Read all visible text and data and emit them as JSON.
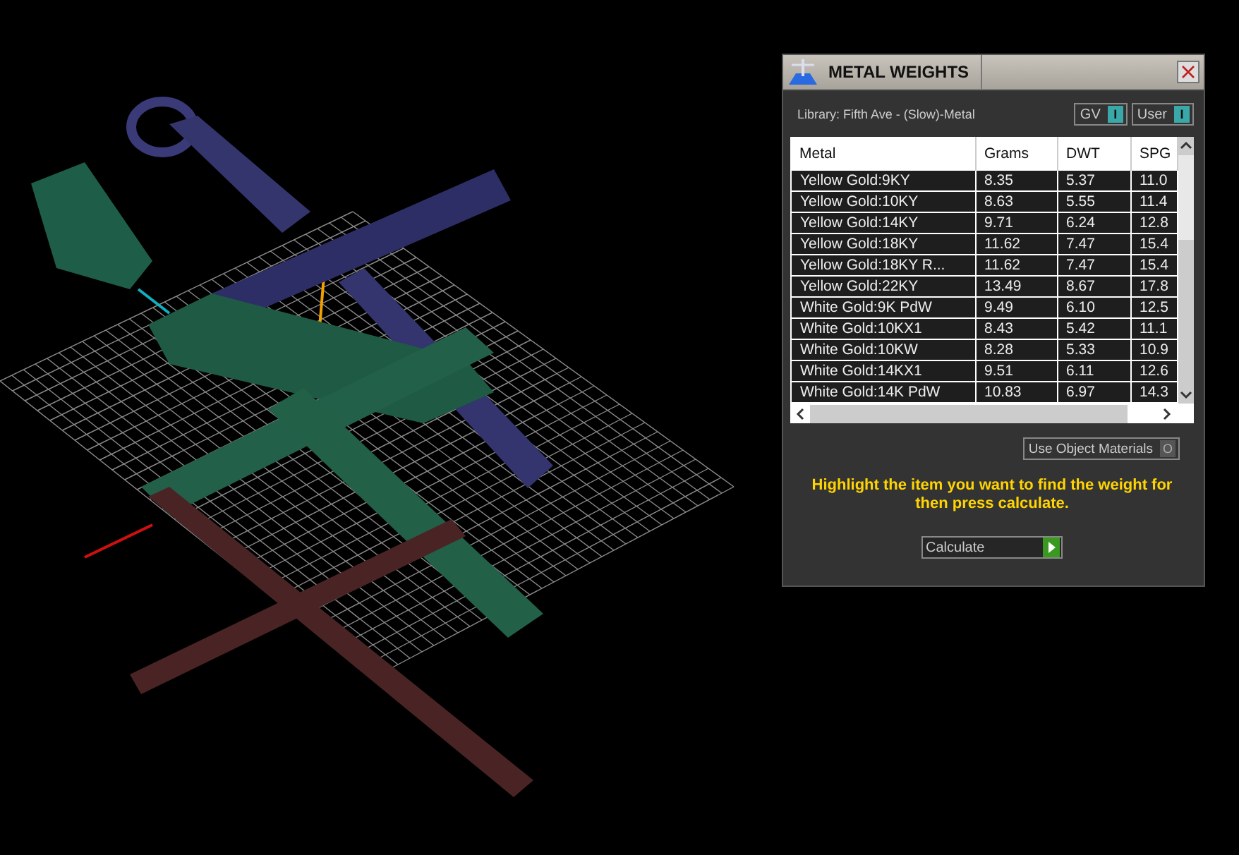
{
  "panel": {
    "title": "METAL WEIGHTS",
    "library": "Library: Fifth Ave - (Slow)-Metal",
    "toggles": [
      {
        "label": "GV",
        "glyph": "I",
        "on": true
      },
      {
        "label": "User",
        "glyph": "I",
        "on": true
      }
    ],
    "table": {
      "columns": [
        "Metal",
        "Grams",
        "DWT",
        "SPG"
      ],
      "rows": [
        {
          "cells": [
            "Yellow Gold:9KY",
            "8.35",
            "5.37",
            "11.0"
          ],
          "selected": false
        },
        {
          "cells": [
            "Yellow Gold:10KY",
            "8.63",
            "5.55",
            "11.4"
          ],
          "selected": false
        },
        {
          "cells": [
            "Yellow Gold:14KY",
            "9.71",
            "6.24",
            "12.8"
          ],
          "selected": false
        },
        {
          "cells": [
            "Yellow Gold:18KY",
            "11.62",
            "7.47",
            "15.4"
          ],
          "selected": false
        },
        {
          "cells": [
            "Yellow Gold:18KY R...",
            "11.62",
            "7.47",
            "15.4"
          ],
          "selected": false
        },
        {
          "cells": [
            "Yellow Gold:22KY",
            "13.49",
            "8.67",
            "17.8"
          ],
          "selected": false
        },
        {
          "cells": [
            "White Gold:9K PdW",
            "9.49",
            "6.10",
            "12.5"
          ],
          "selected": false
        },
        {
          "cells": [
            "White Gold:10KX1",
            "8.43",
            "5.42",
            "11.1"
          ],
          "selected": false
        },
        {
          "cells": [
            "White Gold:10KW",
            "8.28",
            "5.33",
            "10.9"
          ],
          "selected": false
        },
        {
          "cells": [
            "White Gold:14KX1",
            "9.51",
            "6.11",
            "12.6"
          ],
          "selected": false
        },
        {
          "cells": [
            "White Gold:14K PdW",
            "10.83",
            "6.97",
            "14.3"
          ],
          "selected": false
        }
      ]
    },
    "option": {
      "label": "Use Object Materials",
      "glyph": "O",
      "on": false
    },
    "instruction": "Highlight the item you want to find the weight for then press calculate.",
    "button": "Calculate"
  }
}
